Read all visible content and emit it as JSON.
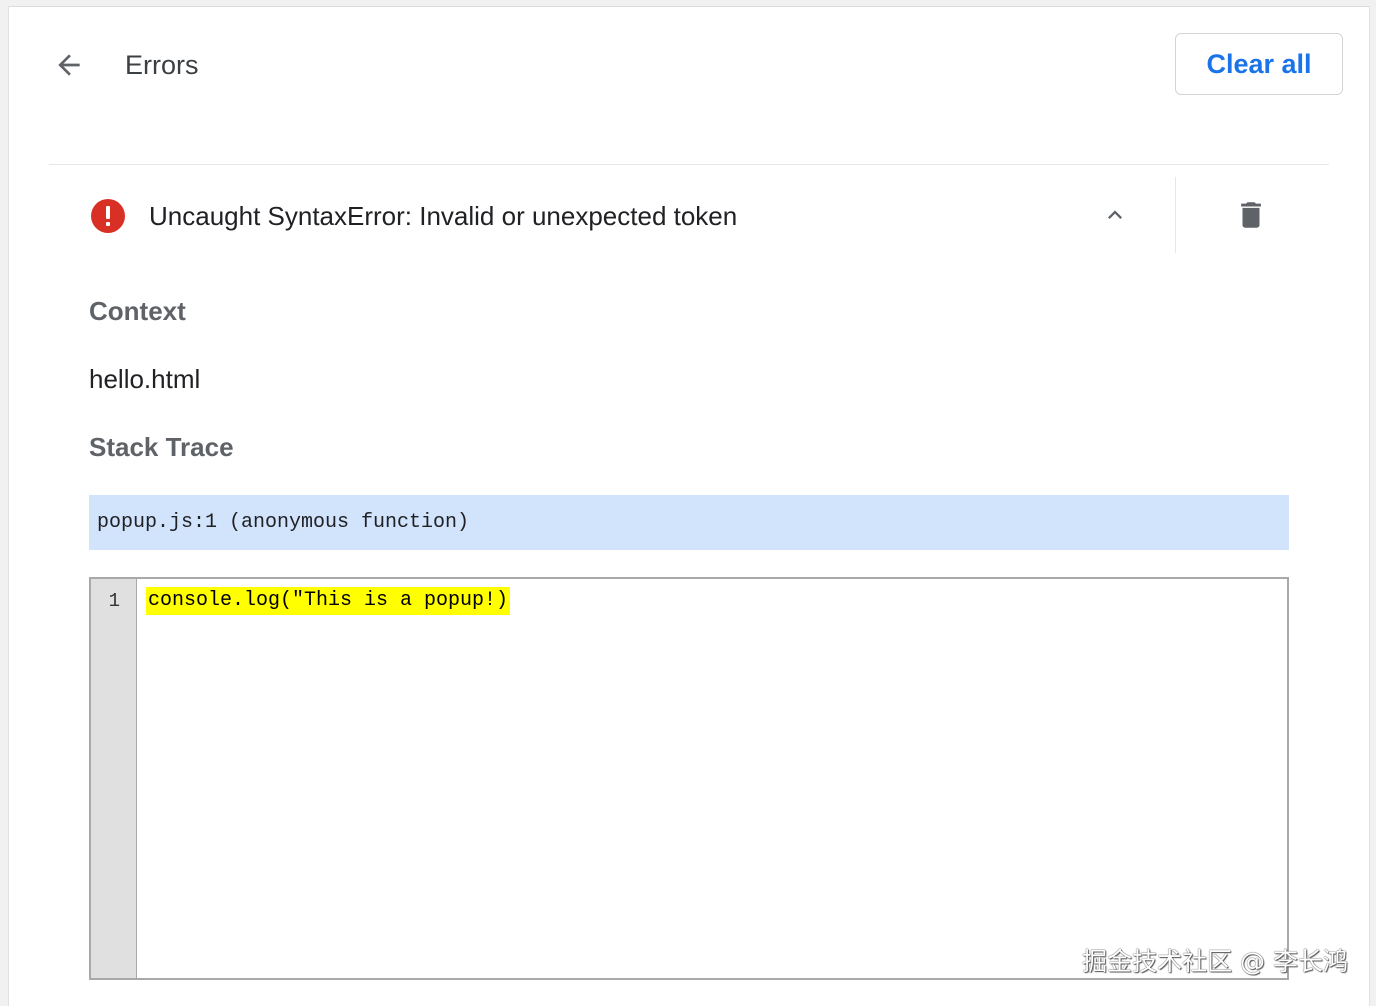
{
  "header": {
    "title": "Errors",
    "clear_all_label": "Clear all"
  },
  "error": {
    "message": "Uncaught SyntaxError: Invalid or unexpected token",
    "icon": "error-icon",
    "icon_color": "#d93025"
  },
  "context": {
    "heading": "Context",
    "value": "hello.html"
  },
  "stack_trace": {
    "heading": "Stack Trace",
    "frames": [
      "popup.js:1 (anonymous function)"
    ],
    "frame_highlight_color": "#d2e3fc"
  },
  "code": {
    "lines": [
      {
        "number": "1",
        "text": "console.log(\"This is a popup!)"
      }
    ],
    "highlight_color": "#ffff00"
  },
  "watermark": "掘金技术社区 @ 李长鸿",
  "colors": {
    "accent": "#1a73e8"
  }
}
